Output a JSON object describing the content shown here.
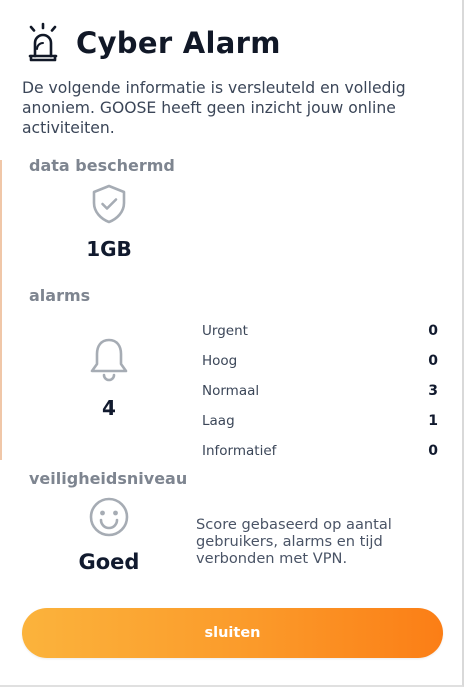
{
  "header": {
    "title": "Cyber Alarm",
    "icon": "alarm-bell-icon"
  },
  "intro": {
    "text": "De volgende informatie is versleuteld en volledig anoniem. GOOSE heeft geen inzicht jouw online activiteiten."
  },
  "data_protected": {
    "label": "data beschermd",
    "icon": "shield-check-icon",
    "value": "1GB"
  },
  "alarms": {
    "label": "alarms",
    "icon": "bell-icon",
    "total": "4",
    "levels": [
      {
        "label": "Urgent",
        "count": "0"
      },
      {
        "label": "Hoog",
        "count": "0"
      },
      {
        "label": "Normaal",
        "count": "3"
      },
      {
        "label": "Laag",
        "count": "1"
      },
      {
        "label": "Informatief",
        "count": "0"
      }
    ]
  },
  "safety": {
    "label": "veiligheidsniveau",
    "icon": "smiley-face-icon",
    "value": "Goed",
    "note": "Score gebaseerd op aantal gebruikers, alarms en tijd verbonden met VPN."
  },
  "actions": {
    "close_label": "sluiten"
  },
  "colors": {
    "accent_start": "#fbb33c",
    "accent_end": "#fb7e16",
    "icon_gray": "#a6acb4",
    "text_dark": "#111a2e"
  }
}
